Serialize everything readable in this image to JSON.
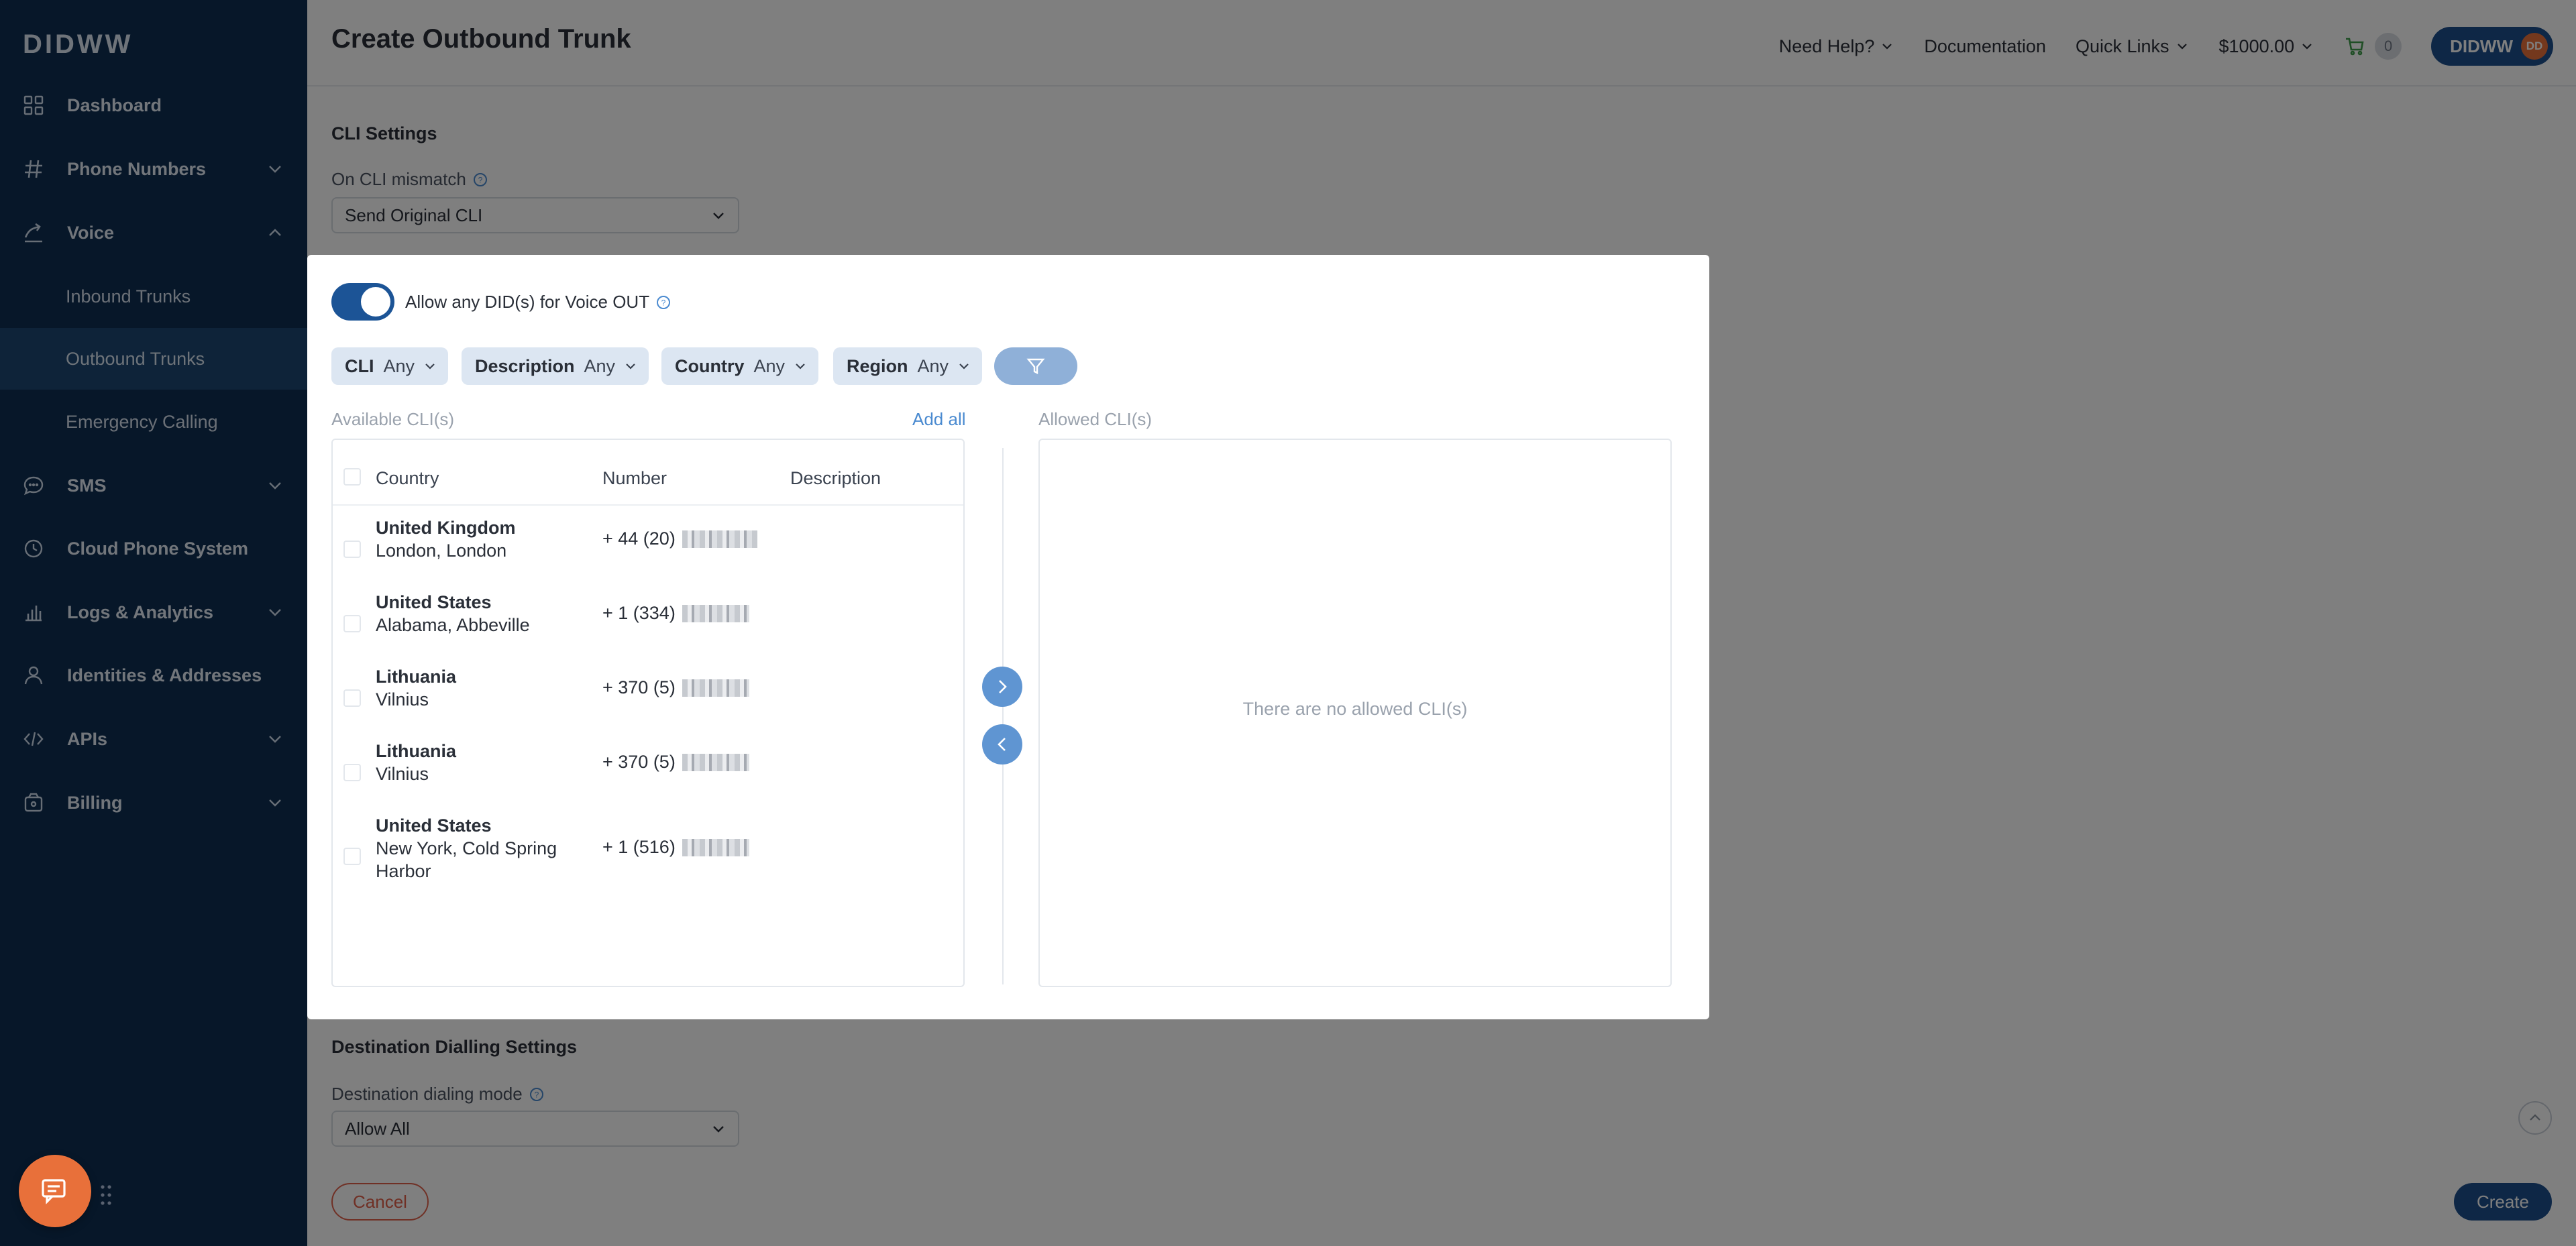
{
  "app": {
    "logo": "DIDWW"
  },
  "sidebar": {
    "items": [
      {
        "label": "Dashboard",
        "icon": "grid-icon"
      },
      {
        "label": "Phone Numbers",
        "icon": "hash-icon"
      },
      {
        "label": "Voice",
        "icon": "phone-forward-icon"
      },
      {
        "label": "SMS",
        "icon": "chat-bubble-icon"
      },
      {
        "label": "Cloud Phone System",
        "icon": "clock-icon"
      },
      {
        "label": "Logs & Analytics",
        "icon": "bar-chart-icon"
      },
      {
        "label": "Identities & Addresses",
        "icon": "person-icon"
      },
      {
        "label": "APIs",
        "icon": "code-icon"
      },
      {
        "label": "Billing",
        "icon": "wallet-icon"
      }
    ],
    "voice_sub": [
      {
        "label": "Inbound Trunks"
      },
      {
        "label": "Outbound Trunks"
      },
      {
        "label": "Emergency Calling"
      }
    ]
  },
  "header": {
    "title": "Create Outbound Trunk",
    "need_help": "Need Help?",
    "documentation": "Documentation",
    "quick_links": "Quick Links",
    "balance": "$1000.00",
    "cart_count": "0",
    "account": "DIDWW",
    "avatar_initials": "DD"
  },
  "form": {
    "cli_section": "CLI Settings",
    "cli_mismatch_label": "On CLI mismatch",
    "cli_mismatch_value": "Send Original CLI",
    "dest_section": "Destination Dialling Settings",
    "dest_mode_label": "Destination dialing mode",
    "dest_mode_value": "Allow All",
    "cancel": "Cancel",
    "create": "Create"
  },
  "modal": {
    "toggle_label": "Allow any DID(s) for Voice OUT",
    "toggle_on": true,
    "filters": [
      {
        "name": "CLI",
        "value": "Any"
      },
      {
        "name": "Description",
        "value": "Any"
      },
      {
        "name": "Country",
        "value": "Any"
      },
      {
        "name": "Region",
        "value": "Any"
      }
    ],
    "available_label": "Available CLI(s)",
    "add_all": "Add all",
    "allowed_label": "Allowed CLI(s)",
    "columns": [
      "Country",
      "Number",
      "Description"
    ],
    "rows": [
      {
        "country": "United Kingdom",
        "region": "London, London",
        "number": "+ 44 (20)"
      },
      {
        "country": "United States",
        "region": "Alabama, Abbeville",
        "number": "+ 1 (334)"
      },
      {
        "country": "Lithuania",
        "region": "Vilnius",
        "number": "+ 370 (5)"
      },
      {
        "country": "Lithuania",
        "region": "Vilnius",
        "number": "+ 370 (5)"
      },
      {
        "country": "United States",
        "region": "New York, Cold Spring Harbor",
        "number": "+ 1 (516)"
      }
    ],
    "empty_allowed": "There are no allowed CLI(s)"
  },
  "colors": {
    "sidebar_bg": "#0f2e52",
    "sidebar_active": "#1c4673",
    "primary": "#1c4f8c",
    "accent_orange": "#e8703a",
    "cancel_red": "#e0614a",
    "link_blue": "#4a8ad0"
  }
}
